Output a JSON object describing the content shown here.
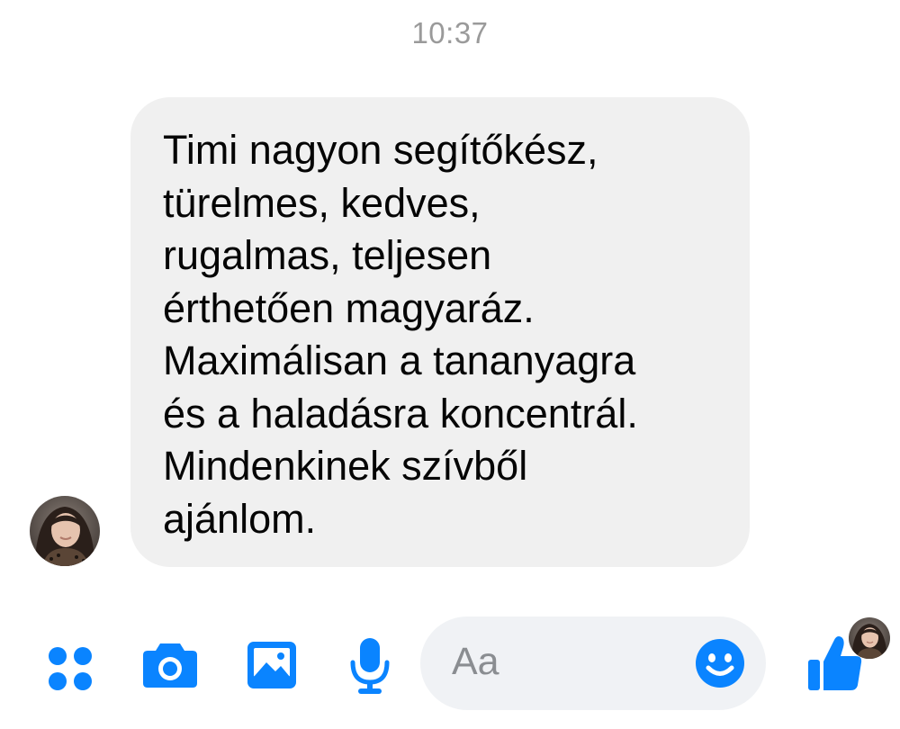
{
  "header": {
    "timestamp": "10:37"
  },
  "message": {
    "sender": "received",
    "text": "Timi nagyon segítőkész,\ntürelmes, kedves,\nrugalmas, teljesen\nérthetően magyaráz.\nMaximálisan a tananyagra\nés a haladásra koncentrál.\nMindenkinek szívből\najánlom."
  },
  "composer": {
    "placeholder": "Aa",
    "tools": [
      "apps-icon",
      "camera-icon",
      "gallery-icon",
      "microphone-icon"
    ],
    "send_icon": "thumbs-up-icon",
    "emoji_icon": "emoji-icon"
  },
  "colors": {
    "accent": "#0A84FF",
    "bubble_bg": "#F0F0F0",
    "timestamp": "#9A9A9A",
    "text": "#050505",
    "input_bg": "#F0F2F5"
  }
}
